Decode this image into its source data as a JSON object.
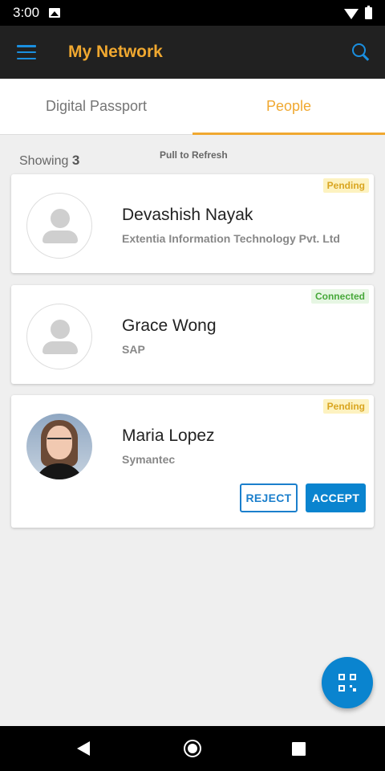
{
  "status_bar": {
    "time": "3:00"
  },
  "app_bar": {
    "title": "My Network"
  },
  "tabs": [
    {
      "label": "Digital Passport",
      "active": false
    },
    {
      "label": "People",
      "active": true
    }
  ],
  "list": {
    "showing_label": "Showing",
    "showing_count": "3",
    "pull_to_refresh": "Pull to Refresh"
  },
  "contacts": [
    {
      "name": "Devashish Nayak",
      "company": "Extentia Information Technology Pvt. Ltd",
      "status": "Pending"
    },
    {
      "name": "Grace Wong",
      "company": "SAP",
      "status": "Connected"
    },
    {
      "name": "Maria Lopez",
      "company": "Symantec",
      "status": "Pending",
      "actions": {
        "reject": "REJECT",
        "accept": "ACCEPT"
      }
    }
  ],
  "colors": {
    "accent": "#f0a830",
    "primary": "#0a84cf",
    "app_bar": "#212121"
  },
  "icons": {
    "menu": "menu-icon",
    "search": "search-icon",
    "fab": "qr-code-icon"
  }
}
